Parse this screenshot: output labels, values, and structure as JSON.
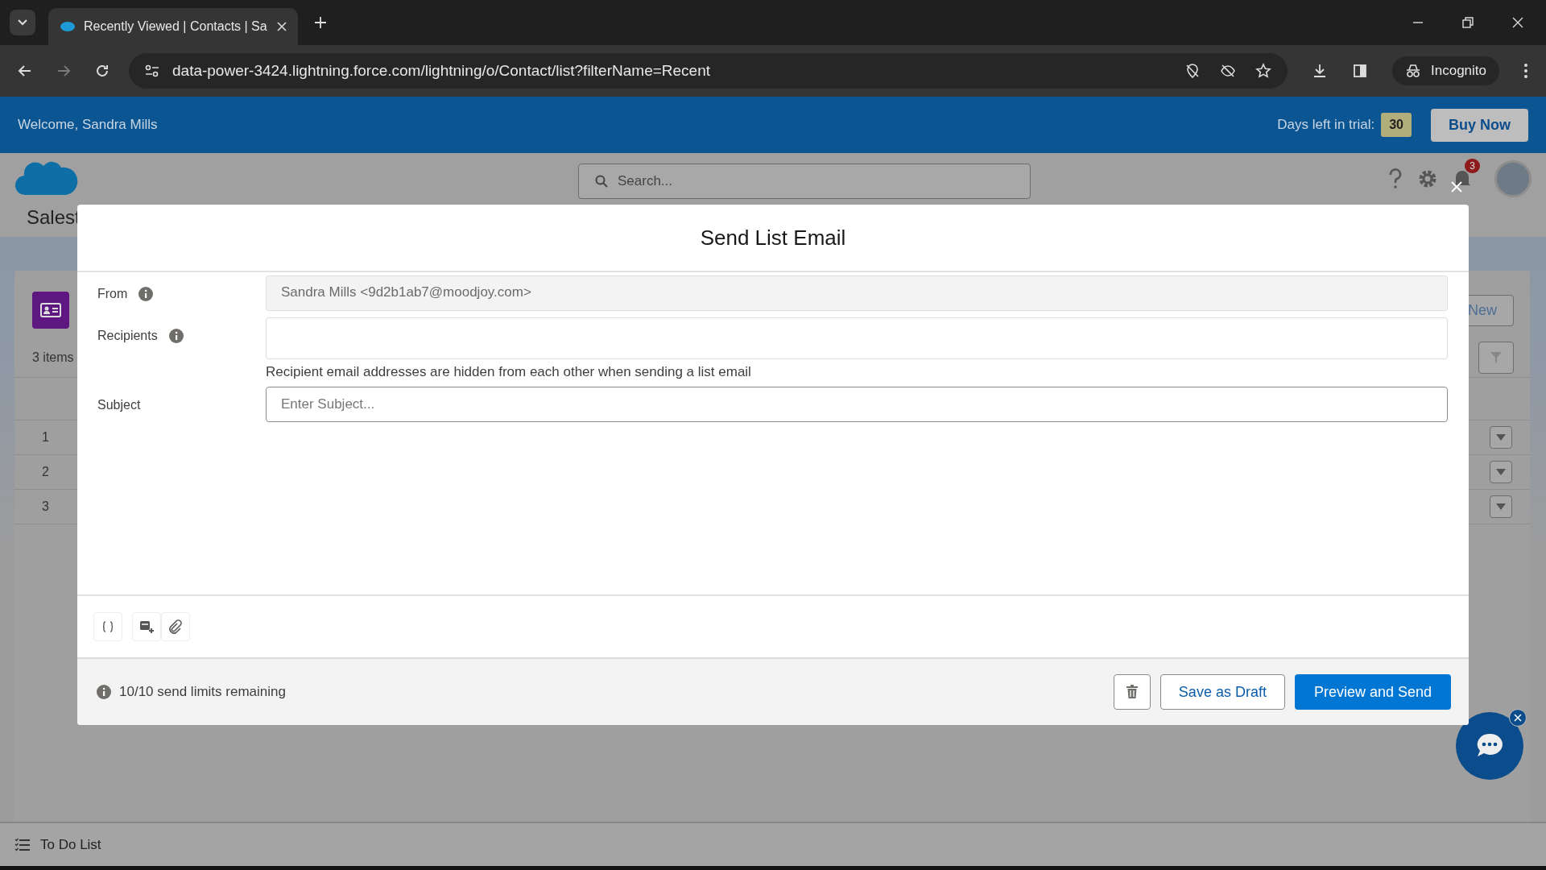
{
  "browser": {
    "tab_title": "Recently Viewed | Contacts | Sa",
    "url": "data-power-3424.lightning.force.com/lightning/o/Contact/list?filterName=Recent",
    "profile": "Incognito"
  },
  "trial_banner": {
    "welcome": "Welcome, Sandra Mills",
    "days_label": "Days left in trial:",
    "days": "30",
    "buy_button": "Buy Now"
  },
  "header": {
    "search_placeholder": "Search...",
    "notification_count": "3",
    "app_name": "Salest"
  },
  "list": {
    "count": "3 items",
    "new_button": "New",
    "rows": [
      "1",
      "2",
      "3"
    ]
  },
  "modal": {
    "title": "Send List Email",
    "from": {
      "label": "From",
      "value": "Sandra Mills <9d2b1ab7@moodjoy.com>"
    },
    "recipients": {
      "label": "Recipients",
      "hint": "Recipient email addresses are hidden from each other when sending a list email"
    },
    "subject": {
      "label": "Subject",
      "placeholder": "Enter Subject..."
    },
    "limits": "10/10 send limits remaining",
    "save_button": "Save as Draft",
    "send_button": "Preview and Send"
  },
  "utility_bar": {
    "todo": "To Do List"
  }
}
